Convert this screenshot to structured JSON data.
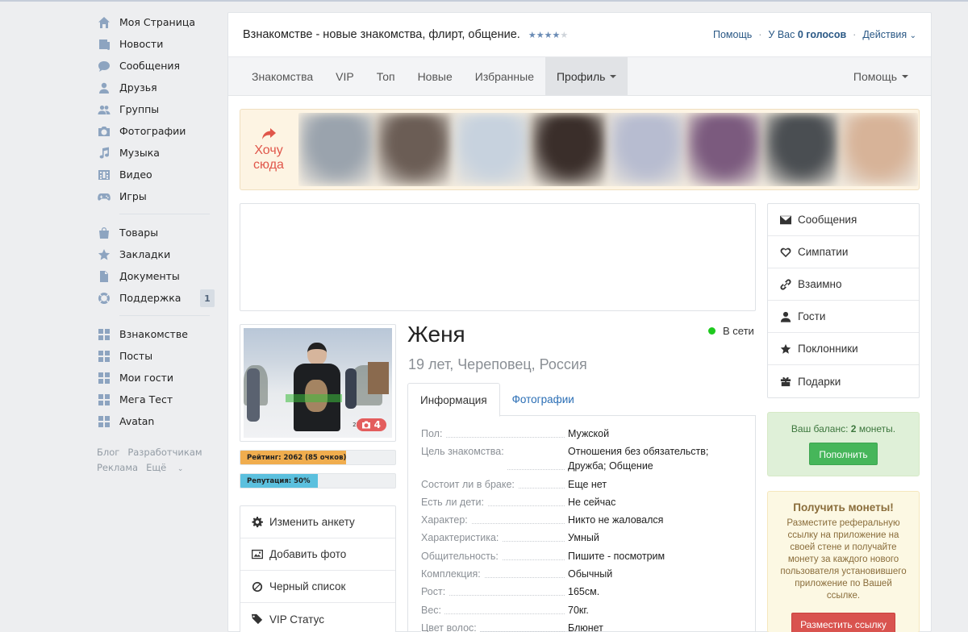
{
  "leftnav": {
    "group1": [
      {
        "label": "Моя Страница",
        "icon": "home-icon"
      },
      {
        "label": "Новости",
        "icon": "news-icon"
      },
      {
        "label": "Сообщения",
        "icon": "messages-icon"
      },
      {
        "label": "Друзья",
        "icon": "friend-icon"
      },
      {
        "label": "Группы",
        "icon": "groups-icon"
      },
      {
        "label": "Фотографии",
        "icon": "camera-icon"
      },
      {
        "label": "Музыка",
        "icon": "music-icon"
      },
      {
        "label": "Видео",
        "icon": "video-icon"
      },
      {
        "label": "Игры",
        "icon": "gamepad-icon"
      }
    ],
    "group2": [
      {
        "label": "Товары",
        "icon": "bag-icon"
      },
      {
        "label": "Закладки",
        "icon": "star-icon"
      },
      {
        "label": "Документы",
        "icon": "document-icon"
      },
      {
        "label": "Поддержка",
        "icon": "lifebuoy-icon",
        "badge": "1"
      }
    ],
    "group3": [
      {
        "label": "Взнакомстве",
        "icon": "app-icon"
      },
      {
        "label": "Посты",
        "icon": "app-icon"
      },
      {
        "label": "Мои гости",
        "icon": "app-icon"
      },
      {
        "label": "Мега Тест",
        "icon": "app-icon"
      },
      {
        "label": "Avatan",
        "icon": "app-icon"
      }
    ],
    "footer": {
      "blog": "Блог",
      "developers": "Разработчикам",
      "ads": "Реклама",
      "more": "Ещё"
    }
  },
  "header": {
    "title": "Взнакомстве - новые знакомства, флирт, общение.",
    "rating_stars": 4,
    "rating_max": 5,
    "help": "Помощь",
    "votes_prefix": "У Вас",
    "votes_value": "0 голосов",
    "actions": "Действия"
  },
  "tabs": {
    "items": [
      "Знакомства",
      "VIP",
      "Топ",
      "Новые",
      "Избранные"
    ],
    "profile": "Профиль",
    "help": "Помощь"
  },
  "banner": {
    "cta_line1": "Хочу",
    "cta_line2": "сюда",
    "photo_colors": [
      "#9aa3ad",
      "#6b5d55",
      "#c7d2de",
      "#3a2e2a",
      "#b7bcd0",
      "#7b5a7e",
      "#4a4e52",
      "#d7b398"
    ]
  },
  "profile": {
    "name": "Женя",
    "subtitle": "19 лет, Череповец, Россия",
    "status": "В сети",
    "photo_count": "4",
    "photo_sticker": "22",
    "rating_label": "Рейтинг: 2062 (85 очков)",
    "rating_fraction": 0.68,
    "rating_color": "#f0ad4e",
    "reputation_label": "Репутация: 50%",
    "reputation_fraction": 0.5,
    "reputation_color": "#5bc0de"
  },
  "actions": [
    {
      "label": "Изменить анкету",
      "icon": "gear-icon"
    },
    {
      "label": "Добавить фото",
      "icon": "picture-icon"
    },
    {
      "label": "Черный список",
      "icon": "ban-icon"
    },
    {
      "label": "VIP Статус",
      "icon": "tag-icon"
    }
  ],
  "profile_tabs": {
    "info": "Информация",
    "photos": "Фотографии"
  },
  "info_rows": [
    {
      "label": "Пол:",
      "value": "Мужской"
    },
    {
      "label": "Цель знакомства:",
      "value": "Отношения без обязательств; Дружба; Общение"
    },
    {
      "label": "Состоит ли в браке:",
      "value": "Еще нет"
    },
    {
      "label": "Есть ли дети:",
      "value": "Не сейчас"
    },
    {
      "label": "Характер:",
      "value": "Никто не жаловался"
    },
    {
      "label": "Характеристика:",
      "value": "Умный"
    },
    {
      "label": "Общительность:",
      "value": "Пишите - посмотрим"
    },
    {
      "label": "Комплекция:",
      "value": "Обычный"
    },
    {
      "label": "Рост:",
      "value": "165см."
    },
    {
      "label": "Вес:",
      "value": "70кг."
    },
    {
      "label": "Цвет волос:",
      "value": "Блюнет"
    }
  ],
  "right_menu": [
    {
      "label": "Сообщения",
      "icon": "envelope-icon"
    },
    {
      "label": "Симпатии",
      "icon": "heart-icon"
    },
    {
      "label": "Взаимно",
      "icon": "link-icon"
    },
    {
      "label": "Гости",
      "icon": "user-icon"
    },
    {
      "label": "Поклонники",
      "icon": "star-icon"
    },
    {
      "label": "Подарки",
      "icon": "gift-icon"
    }
  ],
  "balance": {
    "prefix": "Ваш баланс:",
    "amount": "2",
    "suffix": "монеты.",
    "button": "Пополнить"
  },
  "coins": {
    "title": "Получить монеты!",
    "text": "Разместите реферальную ссылку на приложение на своей стене и получайте монету за каждого нового пользователя установившего приложение по Вашей ссылке.",
    "button": "Разместить ссылку"
  },
  "colors": {
    "accent_blue": "#2a5885",
    "online_green": "#1ec91e",
    "cta_red": "#e0564a"
  }
}
